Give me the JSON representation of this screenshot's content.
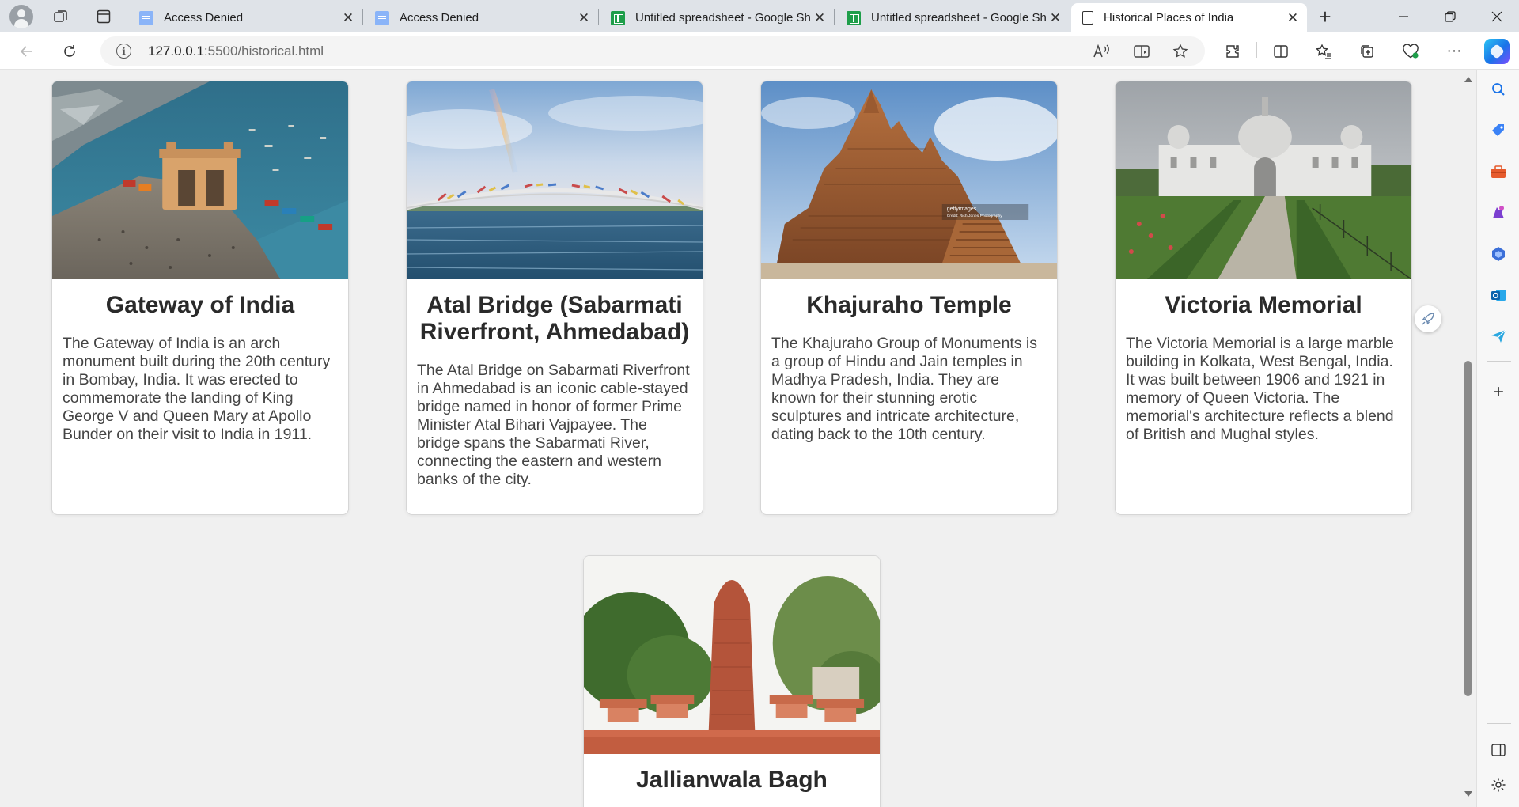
{
  "browser": {
    "tabs": [
      {
        "title": "Access Denied",
        "icon": "doc-icon",
        "active": false
      },
      {
        "title": "Access Denied",
        "icon": "doc-icon",
        "active": false
      },
      {
        "title": "Untitled spreadsheet - Google Sh",
        "icon": "sheets-icon",
        "active": false
      },
      {
        "title": "Untitled spreadsheet - Google Sh",
        "icon": "sheets-icon",
        "active": false
      },
      {
        "title": "Historical Places of India",
        "icon": "page-icon",
        "active": true
      }
    ],
    "url_host": "127.0.0.1",
    "url_path": ":5500/historical.html"
  },
  "places": [
    {
      "name": "Gateway of India",
      "description": "The Gateway of India is an arch monument built during the 20th century in Bombay, India. It was erected to commemorate the landing of King George V and Queen Mary at Apollo Bunder on their visit to India in 1911.",
      "image": "gateway-of-india-photo"
    },
    {
      "name": "Atal Bridge (Sabarmati Riverfront, Ahmedabad)",
      "description": "The Atal Bridge on Sabarmati Riverfront in Ahmedabad is an iconic cable-stayed bridge named in honor of former Prime Minister Atal Bihari Vajpayee. The bridge spans the Sabarmati River, connecting the eastern and western banks of the city.",
      "image": "atal-bridge-photo"
    },
    {
      "name": "Khajuraho Temple",
      "description": "The Khajuraho Group of Monuments is a group of Hindu and Jain temples in Madhya Pradesh, India. They are known for their stunning erotic sculptures and intricate architecture, dating back to the 10th century.",
      "image": "khajuraho-temple-photo"
    },
    {
      "name": "Victoria Memorial",
      "description": "The Victoria Memorial is a large marble building in Kolkata, West Bengal, India. It was built between 1906 and 1921 in memory of Queen Victoria. The memorial's architecture reflects a blend of British and Mughal styles.",
      "image": "victoria-memorial-photo"
    },
    {
      "name": "Jallianwala Bagh",
      "description": "",
      "image": "jallianwala-bagh-photo"
    }
  ],
  "colors": {
    "page_bg": "#f0f0f0",
    "card_bg": "#ffffff",
    "heading": "#2a2a2a",
    "body_text": "#444444"
  }
}
